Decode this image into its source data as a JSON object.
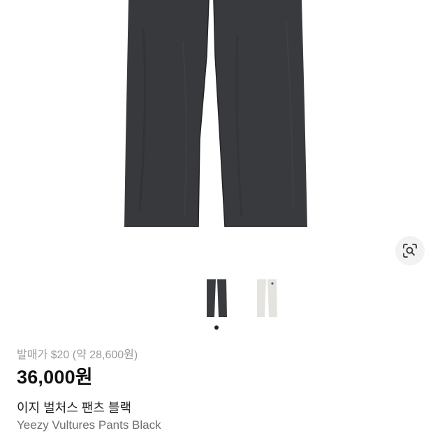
{
  "product": {
    "release_price": "발매가 $20 (약 28,600원)",
    "price": "36,000원",
    "name_ko": "이지 벌처스 팬츠 블랙",
    "name_en": "Yeezy Vultures Pants Black"
  },
  "gallery": {
    "current_index": 1,
    "total": 2,
    "thumbnails": [
      {
        "color": "#3a3b3f",
        "icon": "black-pants-thumbnail"
      },
      {
        "color": "#e4e3e0",
        "icon": "white-pants-thumbnail"
      }
    ],
    "main_image_color": "#38393d",
    "lens_icon": "image-search-lens-icon"
  }
}
